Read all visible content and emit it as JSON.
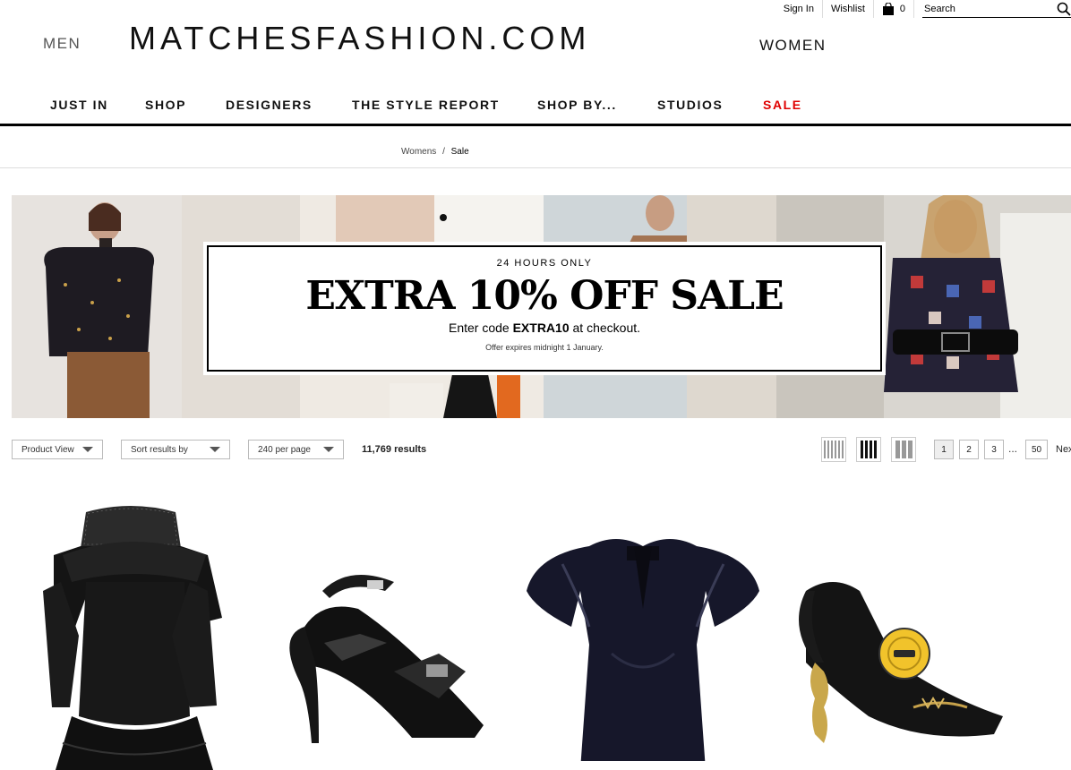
{
  "utility": {
    "sign_in": "Sign In",
    "wishlist": "Wishlist",
    "bag_count": "0",
    "search_placeholder": "Search"
  },
  "header": {
    "men": "MEN",
    "logo": "MATCHESFASHION.COM",
    "women": "WOMEN"
  },
  "nav": {
    "items": [
      "JUST IN",
      "SHOP",
      "DESIGNERS",
      "THE STYLE REPORT",
      "SHOP BY...",
      "STUDIOS",
      "SALE"
    ],
    "sale_color": "#e00000"
  },
  "breadcrumb": {
    "items": [
      "Womens",
      "Sale"
    ],
    "separator": "/"
  },
  "banner": {
    "kicker": "24 HOURS ONLY",
    "headline": "EXTRA 10% OFF SALE",
    "code_prefix": "Enter code ",
    "code": "EXTRA10",
    "code_suffix": " at checkout.",
    "fine_print": "Offer expires midnight 1 January."
  },
  "toolbar": {
    "product_view": "Product View",
    "sort": "Sort results by",
    "per_page": "240 per page",
    "results": "11,769 results"
  },
  "pagination": {
    "pages": [
      "1",
      "2",
      "3",
      "50"
    ],
    "ellipsis": "...",
    "next": "Next",
    "current": "1"
  },
  "products": [
    {
      "icon": "black-lace-ruffle-dress"
    },
    {
      "icon": "black-satin-bow-sandal"
    },
    {
      "icon": "jacquemus-satin-top"
    },
    {
      "icon": "jewelled-heel-button-pump"
    }
  ]
}
